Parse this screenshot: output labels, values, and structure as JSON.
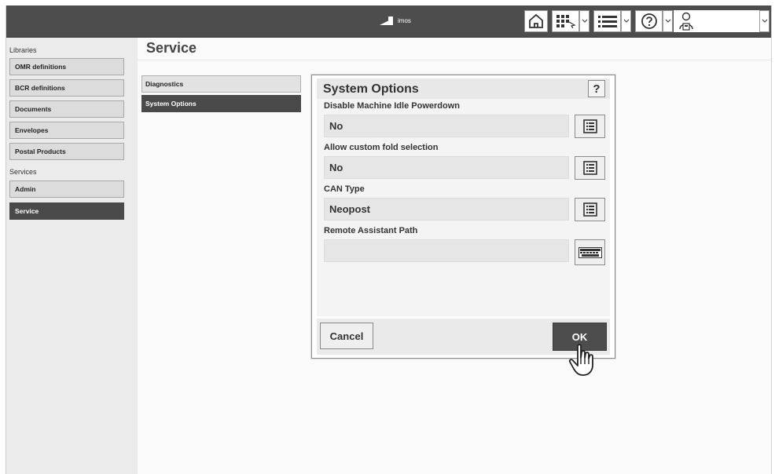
{
  "app": {
    "logo_text": "imos"
  },
  "toolbar": {
    "icons": [
      "home-icon",
      "grid-select-icon",
      "list-icon",
      "help-circle-icon",
      "user-badge-icon"
    ]
  },
  "sidebar": {
    "groups": [
      {
        "label": "Libraries",
        "items": [
          "OMR definitions",
          "BCR definitions",
          "Documents",
          "Envelopes",
          "Postal Products"
        ]
      },
      {
        "label": "Services",
        "items": [
          "Admin",
          "Service"
        ]
      }
    ],
    "active_item": "Service"
  },
  "page": {
    "title": "Service",
    "tabs": [
      "Diagnostics",
      "System Options"
    ],
    "active_tab": "System Options"
  },
  "dialog": {
    "title": "System Options",
    "help_label": "?",
    "fields": [
      {
        "label": "Disable Machine Idle Powerdown",
        "value": "No",
        "button_icon": "list-picker-icon"
      },
      {
        "label": "Allow custom fold selection",
        "value": "No",
        "button_icon": "list-picker-icon"
      },
      {
        "label": "CAN Type",
        "value": "Neopost",
        "button_icon": "list-picker-icon"
      },
      {
        "label": "Remote Assistant Path",
        "value": "",
        "button_icon": "keyboard-icon"
      }
    ],
    "cancel_label": "Cancel",
    "ok_label": "OK"
  },
  "colors": {
    "topbar": "#4d4d4d",
    "active": "#4a4a4a",
    "sidebar_bg": "#ebebeb"
  }
}
